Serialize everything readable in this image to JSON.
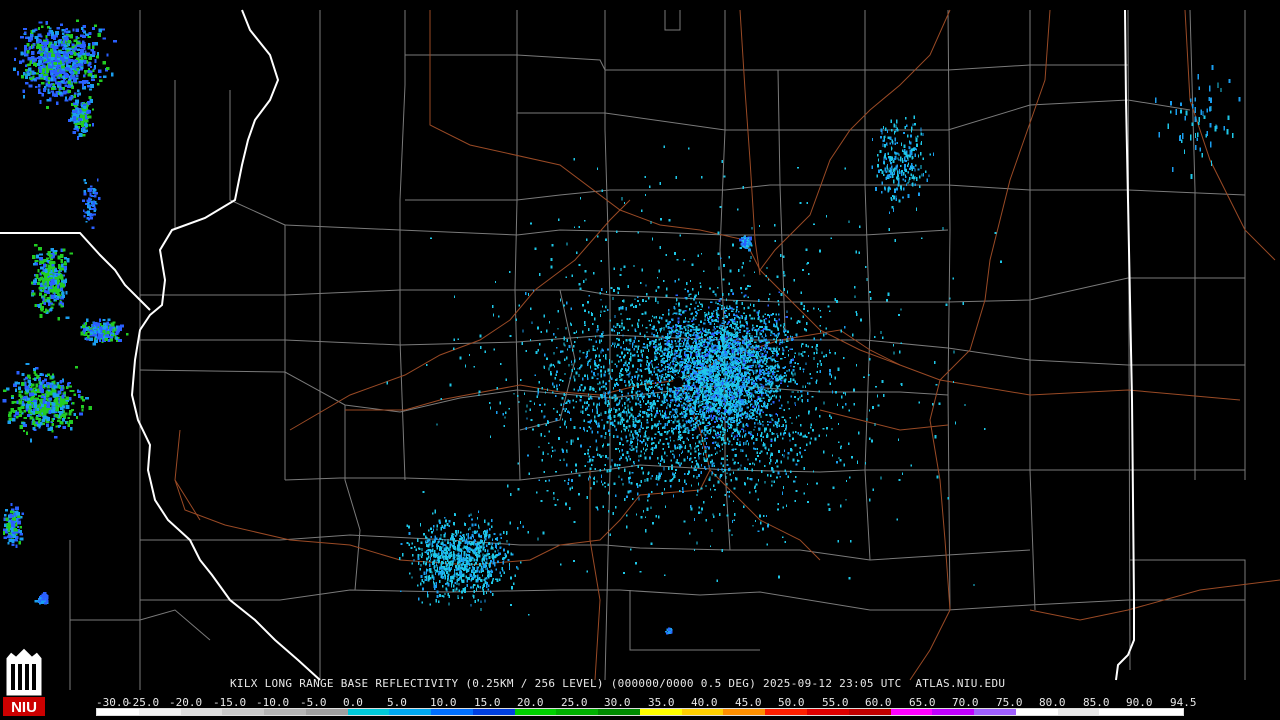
{
  "product": {
    "caption": "KILX LONG RANGE BASE REFLECTIVITY (0.25KM / 256 LEVEL) (000000/0000 0.5 DEG) 2025-09-12 23:05 UTC  ATLAS.NIU.EDU",
    "station": "KILX",
    "timestamp": "2025-09-12 23:05 UTC",
    "source": "ATLAS.NIU.EDU"
  },
  "logo": {
    "text": "NIU",
    "icon": "niu-tower-logo-icon",
    "colors": {
      "red": "#cc0000",
      "white": "#ffffff",
      "black": "#000000"
    }
  },
  "legend": {
    "labels": [
      "-30.0",
      "-25.0",
      "-20.0",
      "-15.0",
      "-10.0",
      "-5.0",
      "0.0",
      "5.0",
      "10.0",
      "15.0",
      "20.0",
      "25.0",
      "30.0",
      "35.0",
      "40.0",
      "45.0",
      "50.0",
      "55.0",
      "60.0",
      "65.0",
      "70.0",
      "75.0",
      "80.0",
      "85.0",
      "90.0",
      "94.5"
    ],
    "colors": [
      "#ffffff",
      "#f0f0f0",
      "#dcdcdc",
      "#c8c8c8",
      "#b4b4b4",
      "#a0a0a0",
      "#00c8d8",
      "#00a8f0",
      "#0070ff",
      "#0040e0",
      "#00d000",
      "#00b000",
      "#008a00",
      "#ffff00",
      "#ffd000",
      "#ff9000",
      "#ff2000",
      "#e00000",
      "#c00000",
      "#ff00ff",
      "#c000ff",
      "#a060ff",
      "#ffffff",
      "#e8e8e8",
      "#ffffff",
      "#ffffff"
    ]
  },
  "map": {
    "state_border_color": "#ffffff",
    "county_line_color": "#7a7a7a",
    "highway_color": "#9a4a25",
    "echo_colors": [
      "#1ec8e8",
      "#1a9ef0",
      "#2a60ff",
      "#22cc22"
    ]
  }
}
